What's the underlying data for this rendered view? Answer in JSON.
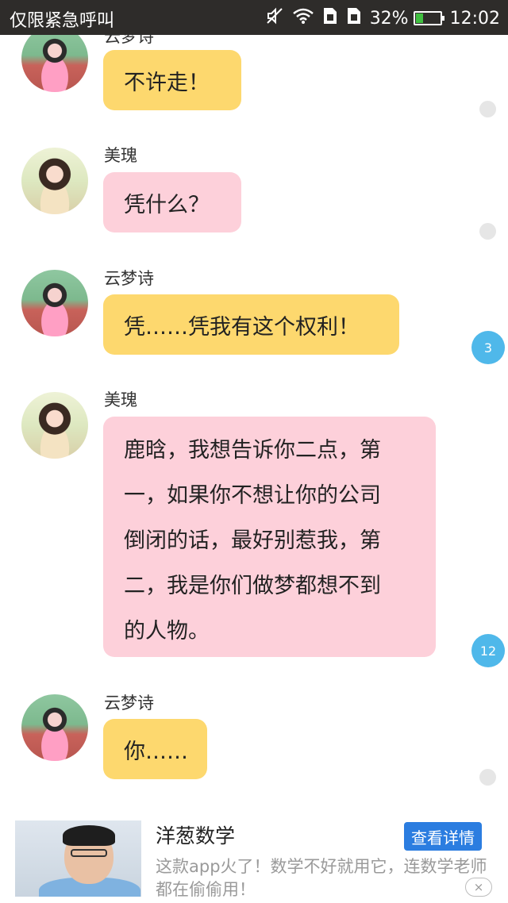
{
  "status_bar": {
    "carrier": "仅限紧急呼叫",
    "battery_percent": "32%",
    "battery_level": 0.32,
    "time": "12:02",
    "icons": [
      "mute-icon",
      "wifi-icon",
      "sim-icon",
      "sim-icon",
      "battery-icon"
    ]
  },
  "messages": [
    {
      "sender": "云梦诗",
      "text": "不许走！",
      "color": "#fdd86e"
    },
    {
      "sender": "美瑰",
      "text": "凭什么？",
      "color": "#fdd0da"
    },
    {
      "sender": "云梦诗",
      "text": "凭……凭我有这个权利！",
      "color": "#fdd86e",
      "comment_count": "3"
    },
    {
      "sender": "美瑰",
      "lines": [
        "鹿晗，我想告诉你二点，第",
        "一，如果你不想让你的公司",
        "倒闭的话，最好别惹我，第",
        "二，我是你们做梦都想不到",
        "的人物。"
      ],
      "color": "#fdd0da",
      "comment_count": "12"
    },
    {
      "sender": "云梦诗",
      "text": "你……",
      "color": "#fdd86e"
    }
  ],
  "ad": {
    "title": "洋葱数学",
    "button_label": "查看详情",
    "description": "这款app火了！数学不好就用它，连数学老师都在偷偷用！",
    "close_icon": "×"
  },
  "colors": {
    "status_bar": "#2e2c2a",
    "yellow_bubble": "#fdd86e",
    "pink_bubble": "#fdd0da",
    "badge": "#4fb8ea",
    "ad_button": "#2b7de0"
  }
}
